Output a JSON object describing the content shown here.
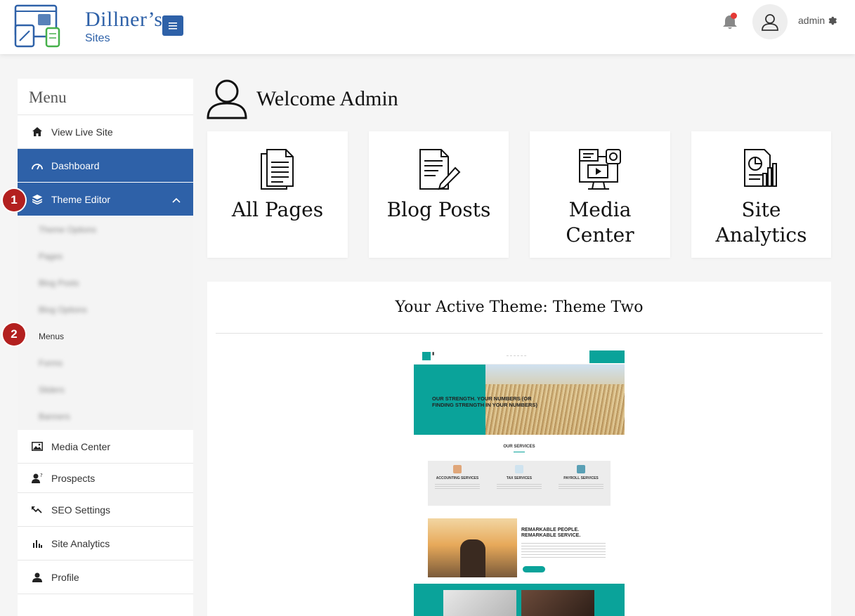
{
  "header": {
    "brand_title": "Dillner’s",
    "brand_subtitle": "Sites",
    "user_label": "admin"
  },
  "sidebar": {
    "heading": "Menu",
    "items": [
      {
        "label": "View Live Site",
        "icon": "home-icon"
      },
      {
        "label": "Dashboard",
        "icon": "speedometer-icon"
      },
      {
        "label": "Theme Editor",
        "icon": "layers-icon"
      },
      {
        "label": "Media Center",
        "icon": "image-icon"
      },
      {
        "label": "Prospects",
        "icon": "user-question-icon"
      },
      {
        "label": "SEO Settings",
        "icon": "trend-icon"
      },
      {
        "label": "Site Analytics",
        "icon": "bar-chart-icon"
      },
      {
        "label": "Profile",
        "icon": "user-icon"
      }
    ],
    "submenu": {
      "visible_item": "Menus"
    }
  },
  "badges": [
    "1",
    "2"
  ],
  "main": {
    "welcome": "Welcome Admin",
    "tiles": [
      {
        "label_1": "All Pages",
        "label_2": ""
      },
      {
        "label_1": "Blog Posts",
        "label_2": ""
      },
      {
        "label_1": "Media",
        "label_2": "Center"
      },
      {
        "label_1": "Site",
        "label_2": "Analytics"
      }
    ],
    "theme": {
      "title": "Your Active Theme: Theme Two"
    }
  },
  "preview": {
    "hero_text": "OUR STRENGTH. YOUR NUMBERS (OR FINDING STRENGTH IN YOUR NUMBERS)",
    "services_title": "OUR SERVICES",
    "services": [
      "ACCOUNTING SERVICES",
      "TAX SERVICES",
      "PAYROLL SERVICES"
    ],
    "remarkable_1": "REMARKABLE PEOPLE.",
    "remarkable_2": "REMARKABLE SERVICE."
  },
  "colors": {
    "primary": "#2e61a8",
    "badge": "#b3201f",
    "notification_dot": "#e53935",
    "preview_teal": "#0aa39a"
  }
}
